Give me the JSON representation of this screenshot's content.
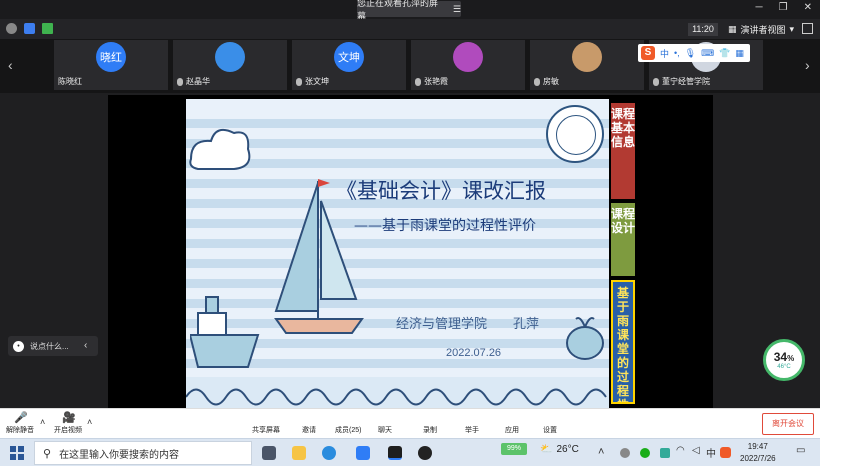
{
  "window": {
    "share_banner": "您正在观看孔萍的屏幕",
    "time": "11:20",
    "view_mode": "演讲者视图"
  },
  "participants": [
    {
      "name": "陈晓红",
      "avatar_text": "晓红",
      "avatar_color": "#2f7df6"
    },
    {
      "name": "赵晶华",
      "avatar_text": "",
      "avatar_color": "#3a8ee8"
    },
    {
      "name": "张文坤",
      "avatar_text": "文坤",
      "avatar_color": "#2f7df6"
    },
    {
      "name": "张艳霞",
      "avatar_text": "",
      "avatar_color": "#b04bbd"
    },
    {
      "name": "房敏",
      "avatar_text": "",
      "avatar_color": "#c89a6a"
    },
    {
      "name": "董宁经管学院",
      "avatar_text": "",
      "avatar_color": "#d0d6e0"
    }
  ],
  "ime": {
    "mode": "中"
  },
  "chat": {
    "placeholder": "说点什么..."
  },
  "slide": {
    "title": "《基础会计》课改汇报",
    "subtitle": "——基于雨课堂的过程性评价",
    "author": "经济与管理学院　　孔萍",
    "date": "2022.07.26",
    "tabs": [
      "课程基本信息",
      "课程设计",
      "基于雨课堂的过程性评"
    ]
  },
  "gauge": {
    "percent": "34",
    "unit": "%",
    "temp": "46°C"
  },
  "toolbar": {
    "mute": "解除静音",
    "video": "开启视频",
    "share": "共享屏幕",
    "invite": "邀请",
    "members": "成员(25)",
    "chat": "聊天",
    "record": "录制",
    "raise_hand": "举手",
    "apps": "应用",
    "settings": "设置",
    "leave": "离开会议"
  },
  "taskbar": {
    "search_placeholder": "在这里输入你要搜索的内容",
    "battery": "99%",
    "temperature": "26°C",
    "time": "19:47",
    "date": "2022/7/26"
  }
}
